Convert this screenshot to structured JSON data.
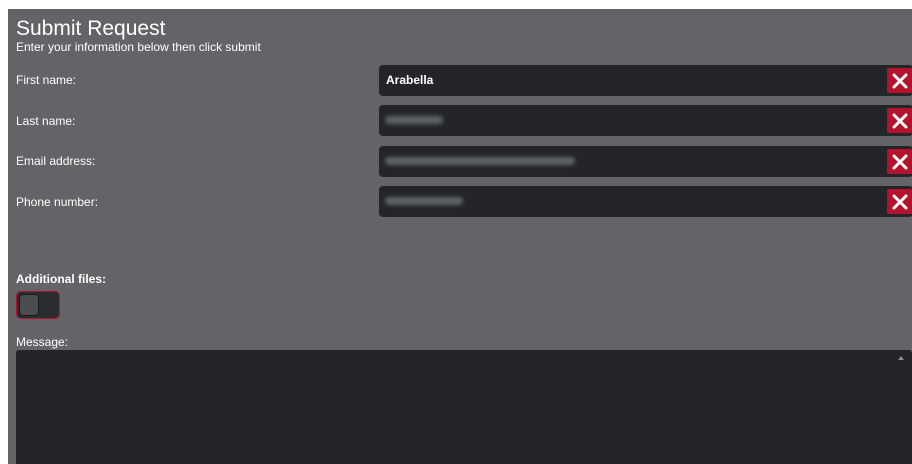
{
  "form": {
    "title": "Submit Request",
    "subtitle": "Enter your information below then click submit",
    "fields": [
      {
        "label": "First name:",
        "value": "Arabella",
        "blurred": false
      },
      {
        "label": "Last name:",
        "value": "",
        "blurred": true
      },
      {
        "label": "Email address:",
        "value": "",
        "blurred": true
      },
      {
        "label": "Phone number:",
        "value": "",
        "blurred": true
      }
    ],
    "additional_files_label": "Additional files:",
    "additional_files_toggle": "off",
    "message_label": "Message:",
    "message_value": ""
  },
  "icons": {
    "clear": "close-icon",
    "scroll": "scroll-up-arrow-icon"
  },
  "colors": {
    "panel": "#636467",
    "field_bg": "#232528",
    "accent": "#b4132e",
    "text": "#ffffff"
  }
}
